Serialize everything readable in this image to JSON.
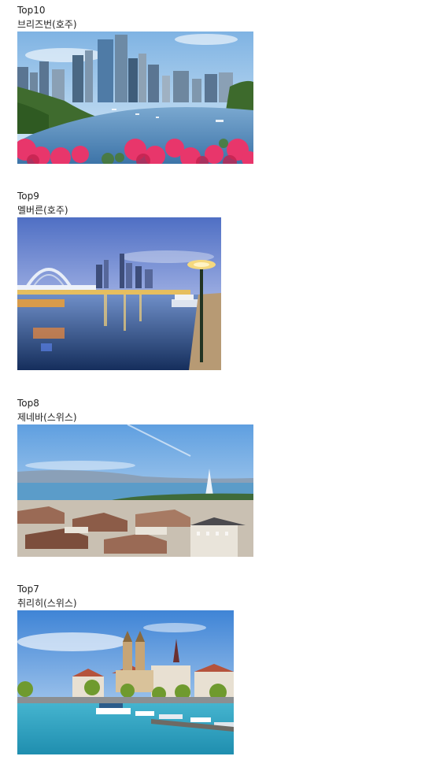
{
  "entries": [
    {
      "rank": "Top10",
      "city": "브리즈번(호주)",
      "image": "brisbane-city-river-photo",
      "colors": {
        "sky": "#9fc8ea",
        "water": "#4f86b8",
        "flowers": "#e8366b",
        "towers": "#5a7592"
      }
    },
    {
      "rank": "Top9",
      "city": "멜버른(호주)",
      "image": "melbourne-river-dusk-photo",
      "colors": {
        "sky": "#7d96d6",
        "water": "#26477c",
        "lights": "#f3c248",
        "bridge": "#e8eef8"
      }
    },
    {
      "rank": "Top8",
      "city": "제네바(스위스)",
      "image": "geneva-lake-rooftops-photo",
      "colors": {
        "sky": "#7fb3e6",
        "water": "#5b9cc9",
        "roofs": "#9a6a55",
        "walls": "#d9d3c8"
      }
    },
    {
      "rank": "Top7",
      "city": "취리히(스위스)",
      "image": "zurich-river-churches-photo",
      "colors": {
        "sky": "#5d9be0",
        "water": "#2fa6c4",
        "towers": "#c7a576",
        "trees": "#6f9a2e"
      }
    }
  ]
}
